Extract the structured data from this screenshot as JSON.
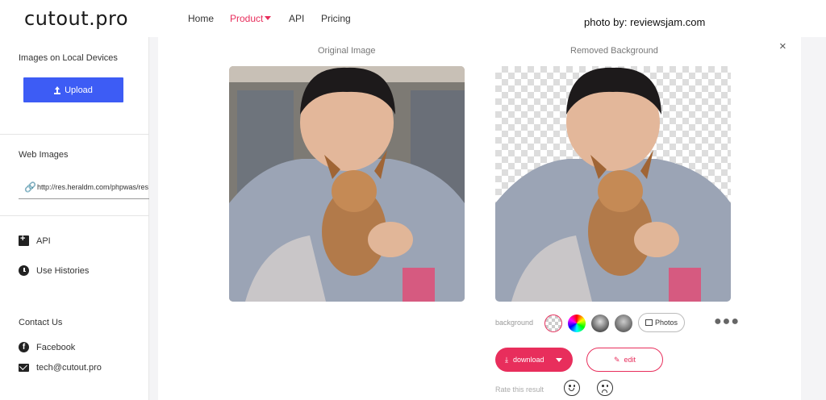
{
  "header": {
    "logo": "cutout.pro",
    "nav": {
      "home": "Home",
      "product": "Product",
      "api": "API",
      "pricing": "Pricing"
    },
    "credit": "photo by: reviewsjam.com"
  },
  "sidebar": {
    "local_heading": "Images on Local Devices",
    "upload_label": "Upload",
    "web_heading": "Web Images",
    "url_value": "http://res.heraldm.com/phpwas/restmb_",
    "items": [
      {
        "label": "API",
        "icon": "api-plus-icon"
      },
      {
        "label": "Use Histories",
        "icon": "clock-icon"
      }
    ],
    "contact_heading": "Contact Us",
    "contacts": [
      {
        "label": "Facebook",
        "icon": "facebook-icon"
      },
      {
        "label": "tech@cutout.pro",
        "icon": "mail-icon"
      }
    ]
  },
  "main": {
    "original_title": "Original Image",
    "removed_title": "Removed Background",
    "close": "×",
    "background_label": "background",
    "photos_label": "Photos",
    "download_label": "download",
    "edit_label": "edit",
    "rate_label": "Rate this result"
  },
  "colors": {
    "accent": "#e82e5c",
    "upload_blue": "#3d5cf5"
  }
}
